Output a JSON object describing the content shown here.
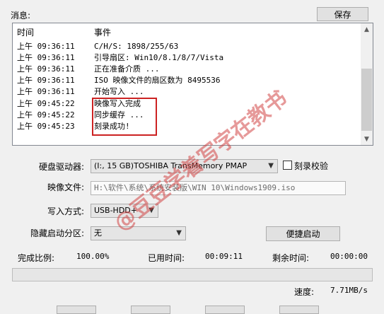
{
  "header": {
    "messages_label": "消息:",
    "save_button": "保存"
  },
  "log": {
    "col_time": "时间",
    "col_event": "事件",
    "rows": [
      {
        "time": "上午 09:36:11",
        "event": "C/H/S: 1898/255/63"
      },
      {
        "time": "上午 09:36:11",
        "event": "引导扇区: Win10/8.1/8/7/Vista"
      },
      {
        "time": "上午 09:36:11",
        "event": "正在准备介质 ..."
      },
      {
        "time": "上午 09:36:11",
        "event": "ISO 映像文件的扇区数为 8495536"
      },
      {
        "time": "上午 09:36:11",
        "event": "开始写入 ..."
      },
      {
        "time": "上午 09:45:22",
        "event": "映像写入完成"
      },
      {
        "time": "上午 09:45:22",
        "event": "同步缓存 ..."
      },
      {
        "time": "上午 09:45:23",
        "event": "刻录成功!"
      }
    ]
  },
  "form": {
    "drive_label": "硬盘驱动器:",
    "drive_value": "(I:, 15 GB)TOSHIBA TransMemory    PMAP",
    "verify_label": "刻录校验",
    "image_label": "映像文件:",
    "image_value": "H:\\软件\\系统\\系统安装版\\WIN 10\\Windows1909.iso",
    "write_mode_label": "写入方式:",
    "write_mode_value": "USB-HDD+",
    "hidden_partition_label": "隐藏启动分区:",
    "hidden_partition_value": "无",
    "quick_boot_button": "便捷启动"
  },
  "status": {
    "complete_label": "完成比例:",
    "complete_value": "100.00%",
    "elapsed_label": "已用时间:",
    "elapsed_value": "00:09:11",
    "remaining_label": "剩余时间:",
    "remaining_value": "00:00:00",
    "speed_label": "速度:",
    "speed_value": "7.71MB/s",
    "progress_fraction": 1.0
  },
  "watermark": "@豆豆学着写字在教书",
  "colors": {
    "highlight": "#cc2222",
    "window_bg": "#f0f0f0"
  }
}
